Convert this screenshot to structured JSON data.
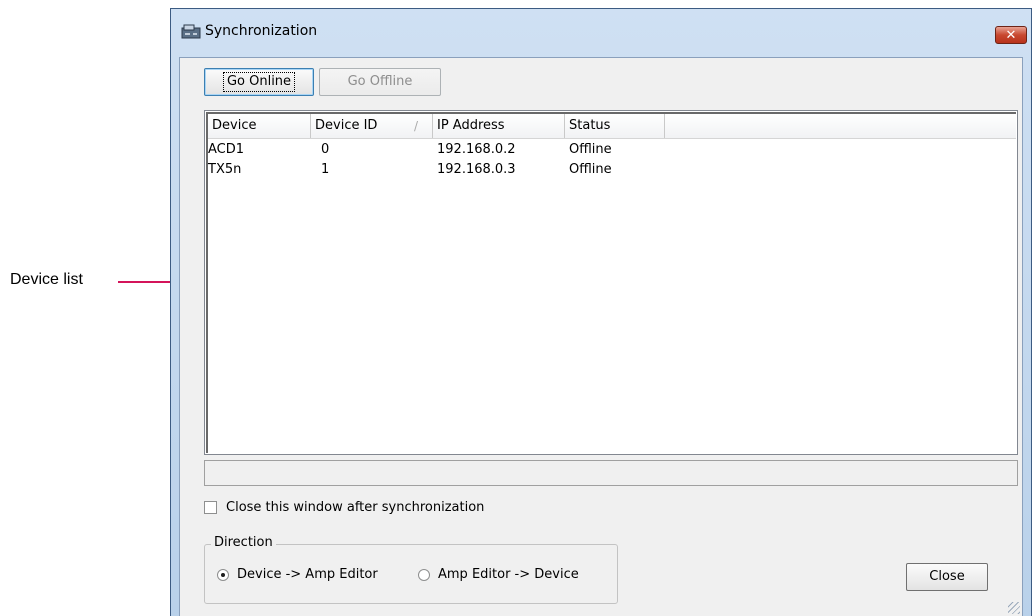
{
  "callout": {
    "label": "Device list",
    "color": "#d4145a"
  },
  "window": {
    "title": "Synchronization",
    "close_glyph": "✕",
    "accent_color": "#b9d1ea"
  },
  "toolbar": {
    "go_online_label": "Go Online",
    "go_offline_label": "Go Offline"
  },
  "device_list": {
    "columns": [
      "Device",
      "Device ID",
      "IP Address",
      "Status"
    ],
    "sort_indicator": "/",
    "rows": [
      {
        "device": "ACD1",
        "device_id": "0",
        "ip": "192.168.0.2",
        "status": "Offline"
      },
      {
        "device": "TX5n",
        "device_id": "1",
        "ip": "192.168.0.3",
        "status": "Offline"
      }
    ]
  },
  "status_strip": {
    "text": ""
  },
  "options": {
    "close_after_sync_label": "Close this window after synchronization",
    "close_after_sync_checked": false
  },
  "direction": {
    "legend": "Direction",
    "options": [
      {
        "label": "Device -> Amp Editor",
        "selected": true
      },
      {
        "label": "Amp Editor -> Device",
        "selected": false
      }
    ]
  },
  "footer": {
    "close_label": "Close"
  }
}
